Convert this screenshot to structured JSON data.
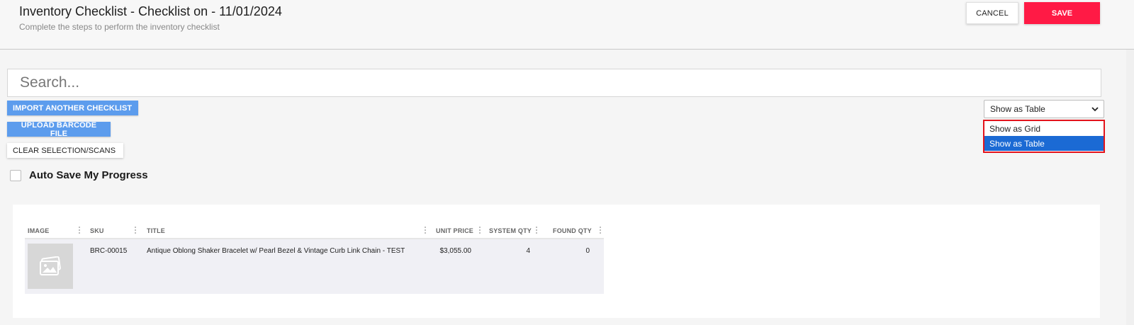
{
  "header": {
    "title": "Inventory Checklist - Checklist on - 11/01/2024",
    "subtitle": "Complete the steps to perform the inventory checklist",
    "cancel_label": "CANCEL",
    "save_label": "SAVE"
  },
  "search": {
    "placeholder": "Search..."
  },
  "actions": {
    "import_label": "IMPORT ANOTHER CHECKLIST",
    "upload_label": "UPLOAD BARCODE FILE",
    "clear_label": "CLEAR SELECTION/SCANS"
  },
  "autosave": {
    "label": "Auto Save My Progress",
    "checked": false
  },
  "view_select": {
    "selected": "Show as Table",
    "options": [
      "Show as Grid",
      "Show as Table"
    ]
  },
  "table": {
    "columns": [
      "IMAGE",
      "SKU",
      "TITLE",
      "UNIT PRICE",
      "SYSTEM QTY",
      "FOUND QTY"
    ],
    "rows": [
      {
        "sku": "BRC-00015",
        "title": "Antique Oblong Shaker Bracelet w/ Pearl Bezel & Vintage Curb Link Chain - TEST",
        "unit_price": "$3,055.00",
        "system_qty": "4",
        "found_qty": "0"
      }
    ]
  },
  "colors": {
    "save": "#ff1a45",
    "primary_blue": "#5c9ced",
    "option_selected": "#1b6ad4",
    "highlight_border": "#e3141c"
  },
  "icons": {
    "chevron": "chevron-down-icon",
    "image_placeholder": "image-placeholder-icon"
  }
}
